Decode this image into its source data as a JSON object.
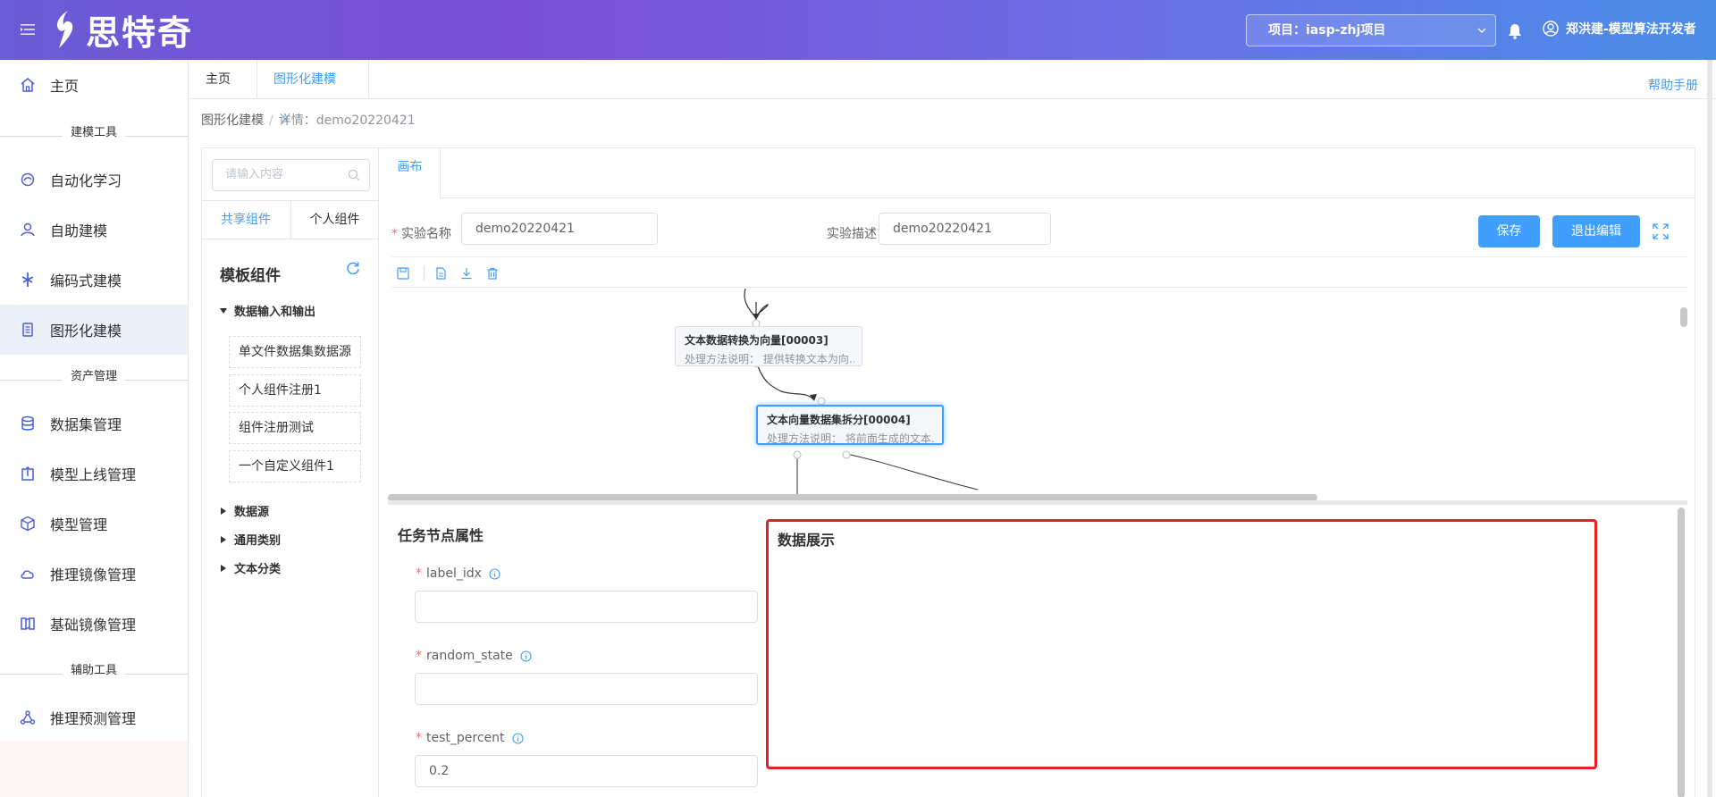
{
  "header": {
    "logo_text": "思特奇",
    "project_label": "项目：iasp-zhj项目",
    "user_label": "郑洪建-模型算法开发者",
    "bg_start": "#6a5bd6",
    "bg_end": "#4a8ee8"
  },
  "sidebar": {
    "home": "主页",
    "group_modeling": "建模工具",
    "items_modeling": [
      "自动化学习",
      "自助建模",
      "编码式建模",
      "图形化建模"
    ],
    "group_assets": "资产管理",
    "items_assets": [
      "数据集管理",
      "模型上线管理",
      "模型管理",
      "推理镜像管理",
      "基础镜像管理"
    ],
    "group_aux": "辅助工具",
    "items_aux": [
      "推理预测管理"
    ],
    "accent": "#4c5fd8"
  },
  "tabs": {
    "home": "主页",
    "graph": "图形化建模",
    "close": "×",
    "help": "帮助手册"
  },
  "breadcrumb": {
    "root": "图形化建模",
    "sep": "/",
    "current": "详情：demo20220421"
  },
  "components": {
    "search_placeholder": "请输入内容",
    "tab_shared": "共享组件",
    "tab_personal": "个人组件",
    "template_title": "模板组件",
    "group_io": "数据输入和输出",
    "io_items": [
      "单文件数据集数据源",
      "个人组件注册1",
      "组件注册测试",
      "一个自定义组件1"
    ],
    "group_source": "数据源",
    "group_general": "通用类别",
    "group_text": "文本分类"
  },
  "canvas": {
    "tab_label": "画布",
    "exp_name_label": "实验名称",
    "exp_name_value": "demo20220421",
    "exp_desc_label": "实验描述",
    "exp_desc_value": "demo20220421",
    "save": "保存",
    "exit_edit": "退出编辑",
    "nodes": [
      {
        "title": "文本数据转换为向量[00003]",
        "desc": "处理方法说明：  提供转换文本为向…"
      },
      {
        "title": "文本向量数据集拆分[00004]",
        "desc": "处理方法说明：  将前面生成的文本…"
      }
    ]
  },
  "properties": {
    "title": "任务节点属性",
    "fields": [
      {
        "label": "label_idx",
        "value": ""
      },
      {
        "label": "random_state",
        "value": ""
      },
      {
        "label": "test_percent",
        "value": "0.2"
      }
    ],
    "data_display_title": "数据展示",
    "highlight_color": "#ea1f1f"
  }
}
